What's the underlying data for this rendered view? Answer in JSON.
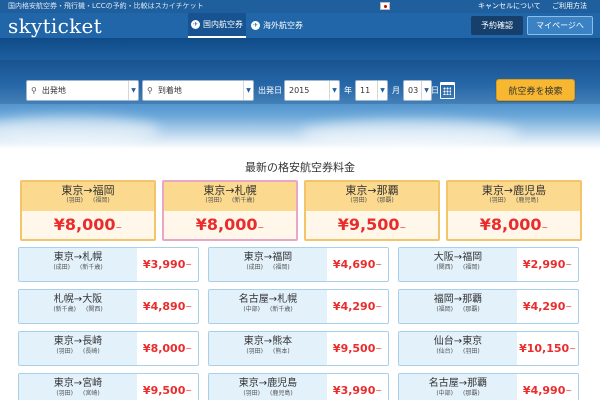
{
  "header": {
    "tagline": "国内格安航空券・飛行機・LCCの予約・比較はスカイチケット",
    "cancel_link": "キャンセルについて",
    "guide_link": "ご利用方法",
    "logo": "skyticket",
    "tabs": [
      {
        "label": "国内航空券",
        "icon": "airplane-icon"
      },
      {
        "label": "海外航空券",
        "icon": "airplane-icon"
      }
    ],
    "reservation_button": "予約確認",
    "mypage_button": "マイページへ"
  },
  "search": {
    "departure": "出発地",
    "arrival": "到着地",
    "date_label": "出発日",
    "year": "2015",
    "year_unit": "年",
    "month": "11",
    "month_unit": "月",
    "day": "03",
    "day_unit": "日",
    "button": "航空券を検索"
  },
  "fares": {
    "title": "最新の格安航空券料金",
    "featured": [
      {
        "from": "東京",
        "to": "福岡",
        "from_airport": "(羽田)",
        "to_airport": "(福岡)",
        "price": "¥8,000"
      },
      {
        "from": "東京",
        "to": "札幌",
        "from_airport": "(羽田)",
        "to_airport": "(新千歳)",
        "price": "¥8,000"
      },
      {
        "from": "東京",
        "to": "那覇",
        "from_airport": "(羽田)",
        "to_airport": "(那覇)",
        "price": "¥9,500"
      },
      {
        "from": "東京",
        "to": "鹿児島",
        "from_airport": "(羽田)",
        "to_airport": "(鹿児島)",
        "price": "¥8,000"
      }
    ],
    "routes": [
      {
        "from": "東京",
        "to": "札幌",
        "from_airport": "(成田)",
        "to_airport": "(新千歳)",
        "price": "¥3,990"
      },
      {
        "from": "東京",
        "to": "福岡",
        "from_airport": "(成田)",
        "to_airport": "(福岡)",
        "price": "¥4,690"
      },
      {
        "from": "大阪",
        "to": "福岡",
        "from_airport": "(関西)",
        "to_airport": "(福岡)",
        "price": "¥2,990"
      },
      {
        "from": "札幌",
        "to": "大阪",
        "from_airport": "(新千歳)",
        "to_airport": "(関西)",
        "price": "¥4,890"
      },
      {
        "from": "名古屋",
        "to": "札幌",
        "from_airport": "(中部)",
        "to_airport": "(新千歳)",
        "price": "¥4,290"
      },
      {
        "from": "福岡",
        "to": "那覇",
        "from_airport": "(福岡)",
        "to_airport": "(那覇)",
        "price": "¥4,290"
      },
      {
        "from": "東京",
        "to": "長崎",
        "from_airport": "(羽田)",
        "to_airport": "(長崎)",
        "price": "¥8,000"
      },
      {
        "from": "東京",
        "to": "熊本",
        "from_airport": "(羽田)",
        "to_airport": "(熊本)",
        "price": "¥9,500"
      },
      {
        "from": "仙台",
        "to": "東京",
        "from_airport": "(仙台)",
        "to_airport": "(羽田)",
        "price": "¥10,150"
      },
      {
        "from": "東京",
        "to": "宮崎",
        "from_airport": "(羽田)",
        "to_airport": "(宮崎)",
        "price": "¥9,500"
      },
      {
        "from": "東京",
        "to": "鹿児島",
        "from_airport": "(羽田)",
        "to_airport": "(鹿児島)",
        "price": "¥3,990"
      },
      {
        "from": "名古屋",
        "to": "那覇",
        "from_airport": "(中部)",
        "to_airport": "(那覇)",
        "price": "¥4,990"
      }
    ],
    "arrow": "→",
    "price_suffix": "~"
  },
  "colors": {
    "header_blue": "#2166a8",
    "price_red": "#ea2c2c",
    "search_button": "#f7b731",
    "featured_cap": "#fbd98e",
    "route_card_bg": "#e3f1fb"
  }
}
